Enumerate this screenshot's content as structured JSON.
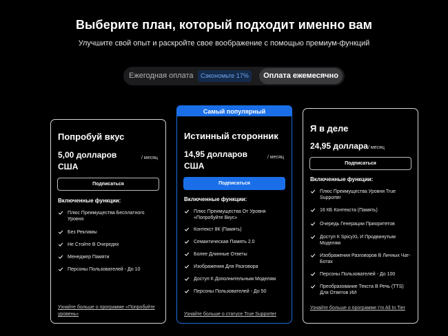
{
  "header": {
    "title": "Выберите план, который подходит именно вам",
    "subtitle": "Улучшите свой опыт и раскройте свое воображение с помощью премиум-функций"
  },
  "billing_toggle": {
    "yearly_label": "Ежегодная оплата",
    "save_badge": "Сэкономьте 17%",
    "monthly_label": "Оплата ежемесячно",
    "selected": "monthly"
  },
  "plans": [
    {
      "name": "Попробуй вкус",
      "price": "5,00 долларов США",
      "per": "/ месяц",
      "subscribe_label": "Подписаться",
      "features_heading": "Включенные функции:",
      "features": [
        "Плюс Преимущества Бесплатного Уровня",
        "Без Рекламы",
        "Не Стойте В Очередях",
        "Менеджер Памяти",
        "Персоны Пользователей - До 10"
      ],
      "more_link": "Узнайте больше о программе «Попробуйте уровень»"
    },
    {
      "badge": "Самый популярный",
      "name": "Истинный сторонник",
      "price": "14,95 долларов США",
      "per": "/ месяц",
      "subscribe_label": "Подписаться",
      "features_heading": "Включенные функции:",
      "features": [
        "Плюс Преимущества От Уровня «Попробуйте Вкус»",
        "Контекст 8К (Память)",
        "Семантическая Память 2.0",
        "Более Длинные Ответы",
        "Изображения Для Разговора",
        "Доступ К Дополнительным Моделям",
        "Персоны Пользователей - До 50"
      ],
      "more_link": "Узнайте больше о статусе True Supporter"
    },
    {
      "name": "Я в деле",
      "price": "24,95 доллара",
      "per": "/ месяц",
      "subscribe_label": "Подписаться",
      "features_heading": "Включенные функции:",
      "features": [
        "Плюс Преимущества Уровня True Supporter",
        "16 КБ Контекста (Память)",
        "Очередь Генерации Приоритетов",
        "Доступ К SpicyXL И Продвинутым Моделям",
        "Изображения Разговоров В Личных Чат-Ботах",
        "Персоны Пользователей - До 100",
        "Преобразование Текста В Речь (TTS) Для Ответов ИИ"
      ],
      "more_link": "Узнайте больше о программе I'm All In Tier"
    }
  ],
  "colors": {
    "background": "#000000",
    "accent": "#1a6fe8",
    "card_border": "#d6d6d6",
    "badge_text": "#6fa3ee"
  },
  "icons": {
    "feature_bullet": "check-icon"
  }
}
